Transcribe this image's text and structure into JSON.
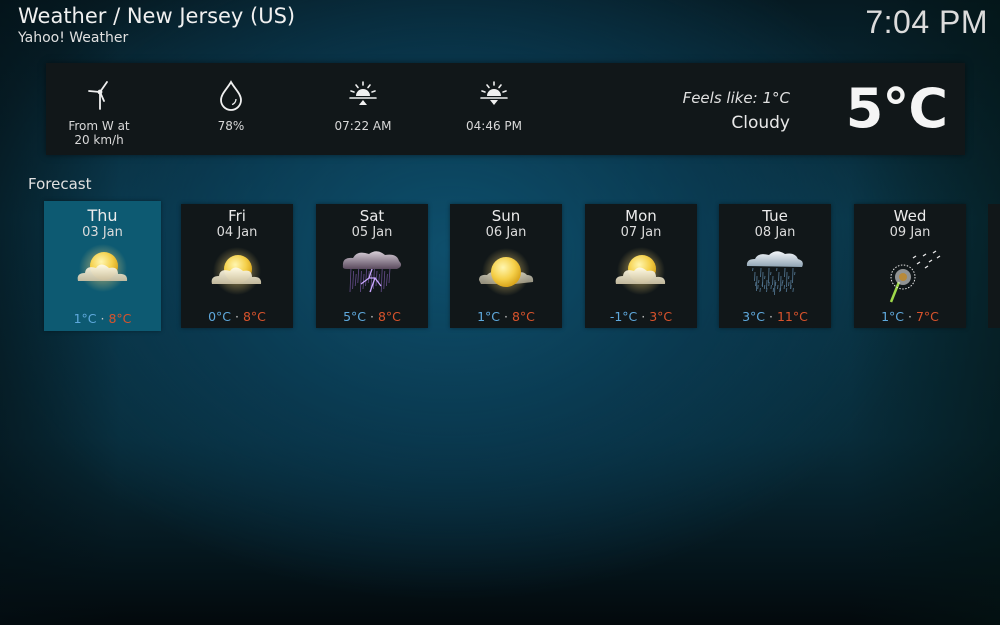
{
  "header": {
    "title": "Weather / New Jersey (US)",
    "provider": "Yahoo! Weather",
    "clock": "7:04 PM"
  },
  "current": {
    "wind": {
      "icon": "wind-turbine-icon",
      "label": "From W at 20 km/h",
      "line1": "From W at",
      "line2": "20 km/h"
    },
    "humidity": {
      "icon": "water-drop-icon",
      "label": "78%"
    },
    "sunrise": {
      "icon": "sunrise-icon",
      "label": "07:22 AM"
    },
    "sunset": {
      "icon": "sunset-icon",
      "label": "04:46 PM"
    },
    "feels_like": "Feels like: 1°C",
    "condition": "Cloudy",
    "temperature": "5°C"
  },
  "forecast": {
    "label": "Forecast",
    "days": [
      {
        "day": "Thu",
        "date": "03 Jan",
        "icon": "partly-cloudy-icon",
        "low": "1°C",
        "high": "8°C",
        "selected": true
      },
      {
        "day": "Fri",
        "date": "04 Jan",
        "icon": "partly-cloudy-icon",
        "low": "0°C",
        "high": "8°C"
      },
      {
        "day": "Sat",
        "date": "05 Jan",
        "icon": "thunderstorm-icon",
        "low": "5°C",
        "high": "8°C"
      },
      {
        "day": "Sun",
        "date": "06 Jan",
        "icon": "mostly-sunny-icon",
        "low": "1°C",
        "high": "8°C"
      },
      {
        "day": "Mon",
        "date": "07 Jan",
        "icon": "partly-cloudy-icon",
        "low": "-1°C",
        "high": "3°C"
      },
      {
        "day": "Tue",
        "date": "08 Jan",
        "icon": "rain-icon",
        "low": "3°C",
        "high": "11°C"
      },
      {
        "day": "Wed",
        "date": "09 Jan",
        "icon": "windy-dandelion-icon",
        "low": "1°C",
        "high": "7°C"
      }
    ],
    "separator": "·"
  },
  "colors": {
    "low_temp": "#5fa9dd",
    "high_temp": "#d9532c",
    "selected_card": "#0d5a72",
    "panel": "#111719"
  }
}
